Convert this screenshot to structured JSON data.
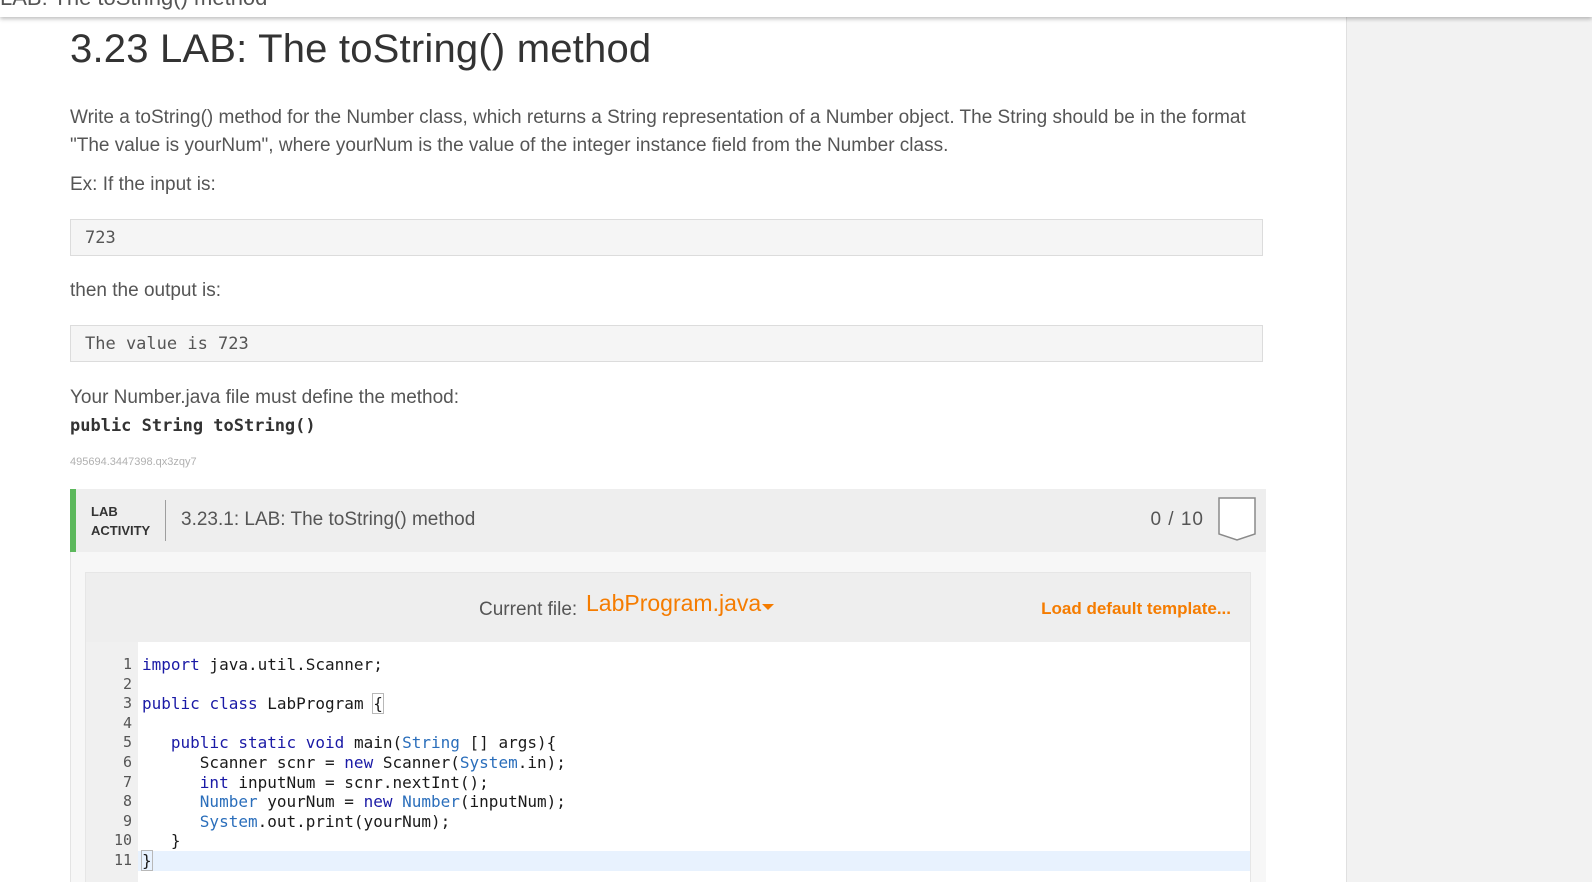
{
  "topbar": {
    "text": "LAB: The toString() method"
  },
  "section": {
    "title": "3.23 LAB: The toString() method",
    "para1": "Write a toString() method for the Number class, which returns a String representation of a Number object. The String should be in the format \"The value is yourNum\", where yourNum is the value of the integer instance field from the Number class.",
    "para2": "Ex: If the input is:",
    "input_example": "723",
    "para3": "then the output is:",
    "output_example": "The value is 723",
    "para4": "Your Number.java file must define the method:",
    "signature": "public String toString()",
    "id_text": "495694.3447398.qx3zqy7"
  },
  "lab": {
    "tag_line1": "LAB",
    "tag_line2": "ACTIVITY",
    "title": "3.23.1: LAB: The toString() method",
    "score": "0 / 10",
    "current_file_label": "Current file:",
    "current_file": "LabProgram.java",
    "load_default": "Load default template..."
  },
  "editor": {
    "line_numbers": [
      "1",
      "2",
      "3",
      "4",
      "5",
      "6",
      "7",
      "8",
      "9",
      "10",
      "11"
    ],
    "lines": [
      [
        {
          "t": "import",
          "c": "kw"
        },
        {
          "t": " java.util.Scanner;",
          "c": ""
        }
      ],
      [],
      [
        {
          "t": "public",
          "c": "kw"
        },
        {
          "t": " ",
          "c": ""
        },
        {
          "t": "class",
          "c": "kw"
        },
        {
          "t": " LabProgram ",
          "c": ""
        },
        {
          "t": "{",
          "c": "bracket"
        }
      ],
      [],
      [
        {
          "t": "   ",
          "c": ""
        },
        {
          "t": "public",
          "c": "kw"
        },
        {
          "t": " ",
          "c": ""
        },
        {
          "t": "static",
          "c": "kw"
        },
        {
          "t": " ",
          "c": ""
        },
        {
          "t": "void",
          "c": "kw"
        },
        {
          "t": " main(",
          "c": ""
        },
        {
          "t": "String",
          "c": "ty"
        },
        {
          "t": " [] args){",
          "c": ""
        }
      ],
      [
        {
          "t": "      Scanner scnr = ",
          "c": ""
        },
        {
          "t": "new",
          "c": "kw"
        },
        {
          "t": " Scanner(",
          "c": ""
        },
        {
          "t": "System",
          "c": "ty"
        },
        {
          "t": ".in);",
          "c": ""
        }
      ],
      [
        {
          "t": "      ",
          "c": ""
        },
        {
          "t": "int",
          "c": "kw"
        },
        {
          "t": " inputNum = scnr.nextInt();",
          "c": ""
        }
      ],
      [
        {
          "t": "      ",
          "c": ""
        },
        {
          "t": "Number",
          "c": "ty"
        },
        {
          "t": " yourNum = ",
          "c": ""
        },
        {
          "t": "new",
          "c": "kw"
        },
        {
          "t": " ",
          "c": ""
        },
        {
          "t": "Number",
          "c": "ty"
        },
        {
          "t": "(inputNum);",
          "c": ""
        }
      ],
      [
        {
          "t": "      ",
          "c": ""
        },
        {
          "t": "System",
          "c": "ty"
        },
        {
          "t": ".out.print(yourNum);",
          "c": ""
        }
      ],
      [
        {
          "t": "   }",
          "c": ""
        }
      ],
      [
        {
          "t": "}",
          "c": "bracket"
        }
      ]
    ]
  }
}
